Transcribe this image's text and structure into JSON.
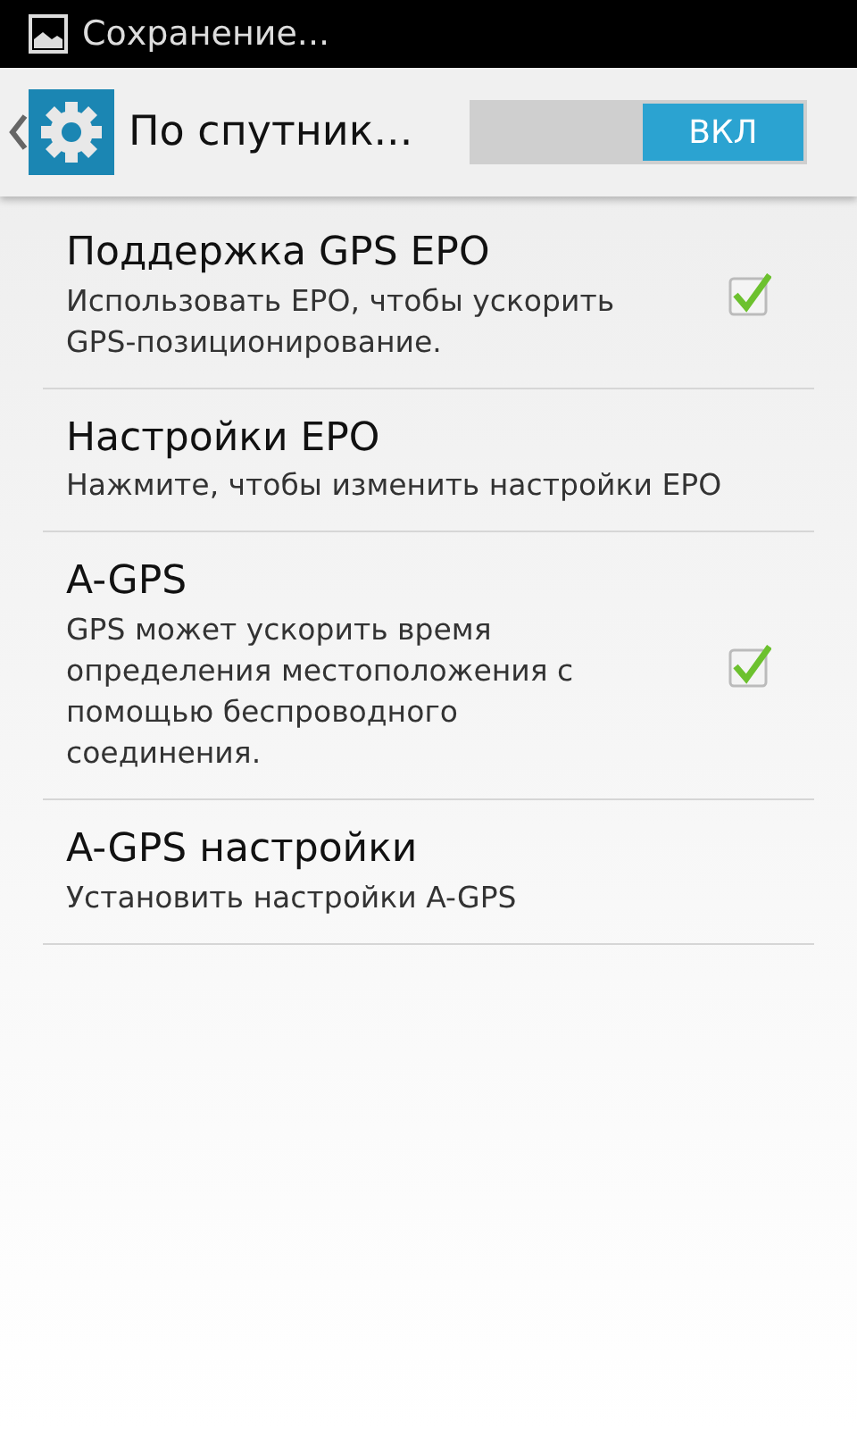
{
  "status_bar": {
    "notification": "Сохранение..."
  },
  "action_bar": {
    "title": "По спутник...",
    "switch": {
      "label": "ВКЛ",
      "on": true
    }
  },
  "items": [
    {
      "kind": "checkbox",
      "title": "Поддержка GPS EPO",
      "summary": "Использовать EPO, чтобы ускорить GPS-позиционирование.",
      "checked": true
    },
    {
      "kind": "plain",
      "title": "Настройки EPO",
      "summary": "Нажмите, чтобы изменить настройки EPO"
    },
    {
      "kind": "checkbox",
      "title": "A-GPS",
      "summary": "GPS может ускорить время определения местоположения с помощью беспроводного соединения.",
      "checked": true
    },
    {
      "kind": "plain",
      "title": "A-GPS настройки",
      "summary": "Установить настройки A-GPS"
    }
  ]
}
